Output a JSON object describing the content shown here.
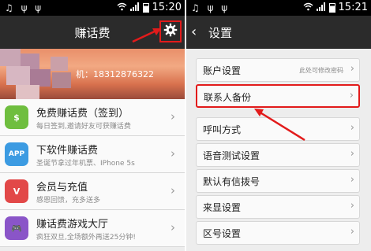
{
  "left": {
    "status": {
      "left_glyphs": "♫ ψ ψ",
      "time": "15:20"
    },
    "title": "赚话费",
    "phone_label": "机：18312876322",
    "items": [
      {
        "title": "免费赚话费（签到）",
        "subtitle": "每日签到,邀请好友可获赚话费",
        "icon_text": "$",
        "icon_color": "#6fbe3f"
      },
      {
        "title": "下软件赚话费",
        "subtitle": "圣诞节拿过年机票、IPhone 5s",
        "icon_text": "APP",
        "icon_color": "#3c9be2"
      },
      {
        "title": "会员与充值",
        "subtitle": "感恩回馈，充多送多",
        "icon_text": "V",
        "icon_color": "#e24848"
      },
      {
        "title": "赚话费游戏大厅",
        "subtitle": "疯狂双旦,全场额外再送25分钟!",
        "icon_text": "🎮",
        "icon_color": "#8a55c8"
      }
    ]
  },
  "right": {
    "status": {
      "left_glyphs": "♫ ψ ψ",
      "time": "15:21"
    },
    "title": "设置",
    "rows": [
      {
        "label": "账户设置",
        "hint": "此处可修改密码"
      },
      {
        "label": "联系人备份",
        "hint": ""
      },
      {
        "label": "呼叫方式",
        "hint": ""
      },
      {
        "label": "语音测试设置",
        "hint": ""
      },
      {
        "label": "默认有信拨号",
        "hint": ""
      },
      {
        "label": "来显设置",
        "hint": ""
      },
      {
        "label": "区号设置",
        "hint": ""
      }
    ]
  },
  "colors": {
    "highlight": "#e21b1b",
    "titlebar": "#2b2b2b",
    "statusbar": "#000000"
  }
}
